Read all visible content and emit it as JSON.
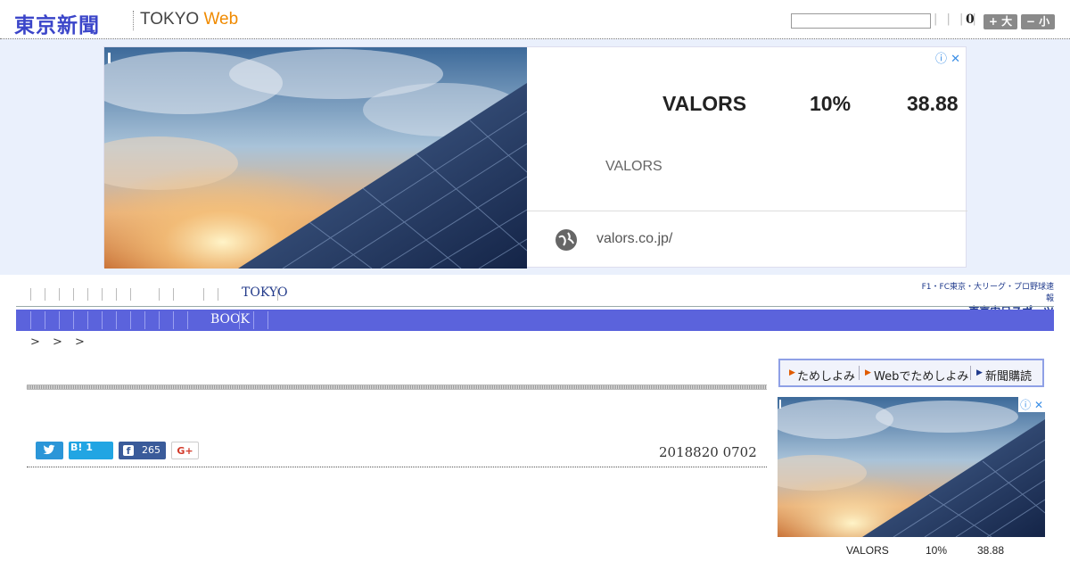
{
  "header": {
    "logo": "東京新聞",
    "logo_sub_tokyo": "TOKYO",
    "logo_sub_web": "Web",
    "bars": "| | | |",
    "count": "0",
    "font_up": "+ 大",
    "font_down": "− 小"
  },
  "ad": {
    "info_icon": "ⓘ ✕",
    "headline_brand": "VALORS",
    "headline_pct": "10%",
    "headline_price": "38.88",
    "subtitle": "VALORS",
    "url": "valors.co.jp/"
  },
  "nav": {
    "tokyo": "TOKYO",
    "book": "BOOK",
    "chunichi_line1": "F1・FC東京・大リーグ・プロ野球速報",
    "chunichi_line2": "東京中日スポーツ"
  },
  "breadcrumb": "> > >",
  "social": {
    "hatena": "B! 1",
    "facebook_count": "265",
    "gplus": "G+"
  },
  "article": {
    "date": "2018820 0702"
  },
  "sidebar": {
    "tameshi1": "ためしよみ",
    "tameshi2": "Webでためしよみ",
    "subscribe": "新聞購読",
    "ad_brand": "VALORS",
    "ad_pct": "10%",
    "ad_price": "38.88",
    "ad_info": "ⓘ ✕"
  },
  "colors": {
    "nav_bar": "#5b63dc",
    "logo": "#3b45c9",
    "web_accent": "#f08a00",
    "ad_band": "#eaf0fc"
  }
}
